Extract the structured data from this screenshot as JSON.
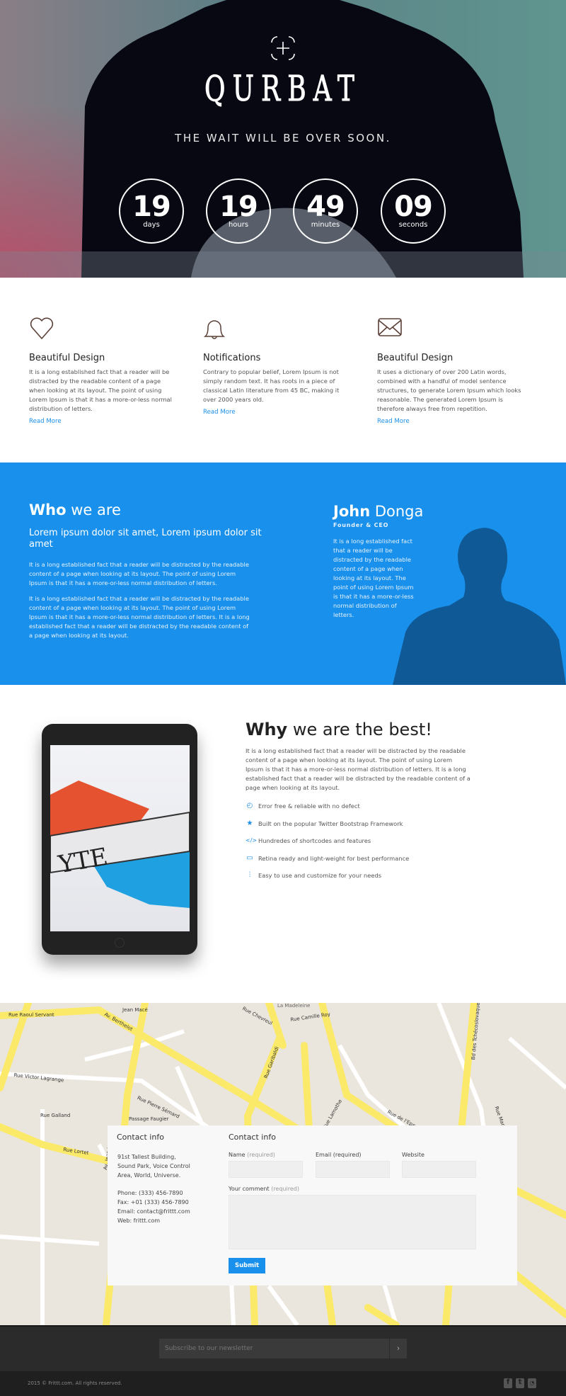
{
  "hero": {
    "brand": "QURBAT",
    "tagline": "THE WAIT WILL BE OVER SOON.",
    "countdown": [
      {
        "value": "19",
        "unit": "days"
      },
      {
        "value": "19",
        "unit": "hours"
      },
      {
        "value": "49",
        "unit": "minutes"
      },
      {
        "value": "09",
        "unit": "seconds"
      }
    ]
  },
  "features": [
    {
      "icon": "heart-icon",
      "title": "Beautiful Design",
      "text": "It is a long established fact that a reader will be distracted by the readable content of a page when looking at its layout. The point of using Lorem Ipsum is that it has a more-or-less normal distribution of letters.",
      "link": "Read More"
    },
    {
      "icon": "bell-icon",
      "title": "Notifications",
      "text": "Contrary to popular belief, Lorem Ipsum is not simply random text. It has roots in a piece of classical Latin literature from 45 BC, making it over 2000 years old.",
      "link": "Read More"
    },
    {
      "icon": "envelope-icon",
      "title": "Beautiful Design",
      "text": "It uses a dictionary of over 200 Latin words, combined with a handful of model sentence structures, to generate Lorem Ipsum which looks reasonable. The generated Lorem Ipsum is therefore always free from repetition.",
      "link": "Read More"
    }
  ],
  "about": {
    "title_bold": "Who",
    "title_light": "we are",
    "subtitle": "Lorem ipsum dolor sit amet, Lorem ipsum dolor sit amet",
    "para1": "It is a long established fact that a reader will be distracted by the readable content of a page when looking at its layout. The point of using Lorem Ipsum is that it has a more-or-less normal distribution of letters.",
    "para2": "It is a long established fact that a reader will be distracted by the readable content of a page when looking at its layout. The point of using Lorem Ipsum is that it has a more-or-less normal distribution of letters. It is a long established fact that a reader will be distracted by the readable content of a page when looking at its layout.",
    "person_first": "John",
    "person_last": "Donga",
    "person_role": "Founder & CEO",
    "person_bio": "It is a long established fact that a reader will be distracted by the readable content of a page when looking at its layout. The point of using Lorem Ipsum is that it has a more-or-less normal distribution of letters."
  },
  "why": {
    "title_bold": "Why",
    "title_light": "we are the best!",
    "text": "It is a long established fact that a reader will be distracted by the readable content of a page when looking at its layout. The point of using Lorem Ipsum is that it has a more-or-less normal distribution of letters. It is a long established fact that a reader will be distracted by the readable content of a page when looking at its layout.",
    "items": [
      {
        "icon": "check-circle-icon",
        "text": "Error free & reliable with no defect"
      },
      {
        "icon": "star-icon",
        "text": "Built on the popular Twitter Bootstrap Framework"
      },
      {
        "icon": "code-icon",
        "text": "Hundredes of shortcodes and features"
      },
      {
        "icon": "monitor-icon",
        "text": "Retina ready and light-weight for best performance"
      },
      {
        "icon": "sliders-icon",
        "text": "Easy to use and customize for your needs"
      }
    ]
  },
  "map": {
    "labels": [
      "Rue Raoul Servant",
      "Av. Berthelot",
      "Jean Macé",
      "Rue Camille Roy",
      "Rue Chevreul",
      "Rue Garibaldi",
      "Rue de l'Epargne",
      "Rue Victor Lagrange",
      "Rue Galland",
      "Rue Lortet",
      "Av. Jean Jaurès",
      "Rue Pierre Sémard",
      "Passage Faugier",
      "Rue Lamothe",
      "Bd des Tchécoslovaques",
      "Rue Marius Berliet",
      "La Madeleine"
    ]
  },
  "contact": {
    "info_title": "Contact info",
    "address": "91st Tallest Building, Sound Park, Voice Control Area, World, Universe.",
    "phone": "Phone: (333) 456-7890",
    "fax": "Fax: +01 (333) 456-7890",
    "email": "Email: contact@frittt.com",
    "web": "Web: frittt.com",
    "form_title": "Contact info",
    "name_label": "Name",
    "email_label": "Email",
    "website_label": "Website",
    "comment_label": "Your comment",
    "required": "(required)",
    "submit": "Submit"
  },
  "footer": {
    "newsletter_placeholder": "Subscribe to our newsletter",
    "newsletter_button": "›",
    "copyright": "2015 © Frittt.com. All rights reserved.",
    "social": [
      "facebook-icon",
      "twitter-icon",
      "rss-icon"
    ]
  },
  "colors": {
    "accent": "#1991ec",
    "dark_blue": "#0f5a96",
    "footer": "#2b2b2b",
    "road": "#fdf07a"
  }
}
